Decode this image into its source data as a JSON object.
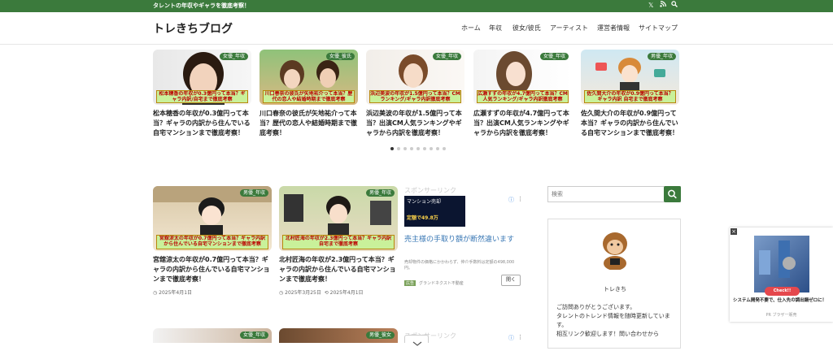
{
  "topbar": {
    "tagline": "タレントの年収やギャラを徹底考察！",
    "icons": [
      "x-icon",
      "rss-icon",
      "search-icon"
    ]
  },
  "header": {
    "logo": "トレきちブログ",
    "nav": [
      "ホーム",
      "年収",
      "彼女/彼氏",
      "アーティスト",
      "運営者情報",
      "サイトマップ"
    ]
  },
  "slider": {
    "cards": [
      {
        "category": "女優_年収",
        "caption": "松本穂香の年収が0.3億円って本当？ギャラ内訳/自宅まで徹底考察",
        "title": "松本穂香の年収が0.3億円って本当？ギャラの内訳から住んでいる自宅マンションまで徹底考察！"
      },
      {
        "category": "女優_彼氏",
        "caption": "川口春奈の彼氏が矢地祐介って本当？歴代の恋人や結婚時期まで徹底考察",
        "title": "川口春奈の彼氏が矢地祐介って本当？歴代の恋人や結婚時期まで徹底考察！"
      },
      {
        "category": "女優_年収",
        "caption": "浜辺美波の年収が1.5億円って本当？CMランキング/ギャラ内訳徹底考察",
        "title": "浜辺美波の年収が1.5億円って本当？出演CM人気ランキングやギャラから内訳を徹底考察！"
      },
      {
        "category": "女優_年収",
        "caption": "広瀬すずの年収が4.7億円って本当？CM人気ランキング/ギャラ内訳徹底考察",
        "title": "広瀬すずの年収が4.7億円って本当？出演CM人気ランキングやギャラから内訳を徹底考察！"
      },
      {
        "category": "男優_年収",
        "caption": "佐久間大介の年収が0.9億円って本当？ギャラ内訳 自宅まで徹底考察",
        "title": "佐久間大介の年収が0.9億円って本当？ギャラの内訳から住んでいる自宅マンションまで徹底考察！"
      }
    ],
    "dots": 9
  },
  "main": {
    "cards": [
      {
        "category": "男優_年収",
        "caption": "宮舘涼太の年収が0.7億円って本当？ギャラ内訳から住んでいる自宅マンションまで徹底考察",
        "title": "宮舘涼太の年収が0.7億円って本当？ギャラの内訳から住んでいる自宅マンションまで徹底考察！",
        "date": "2025年4月1日",
        "updated": ""
      },
      {
        "category": "男優_年収",
        "caption": "北村匠海の年収が2.3億円って本当？ギャラ内訳 自宅まで徹底考察",
        "title": "北村匠海の年収が2.3億円って本当？ギャラの内訳から住んでいる自宅マンションまで徹底考察！",
        "date": "2025年3月25日",
        "updated": "2025年4月1日"
      }
    ],
    "ad": {
      "label": "スポンサーリンク",
      "image_text": "マンション売却",
      "image_amount": "定額で49.8万",
      "headline": "売主様の手取り額が断然違います",
      "body": "売却物件の価格にかかわらず、仲介手数料は定額の498,000円。",
      "sponsor_badge": "広告",
      "sponsor": "グランドネクスト不動産",
      "button": "開く"
    },
    "lower_cards": [
      {
        "category": "女優_年収"
      },
      {
        "category": "男優_彼女"
      }
    ]
  },
  "sidebar": {
    "search_placeholder": "検索",
    "profile": {
      "name": "トレきち",
      "text1": "ご訪問ありがとうございます。",
      "text2": "タレントのトレンド情報を随時更新しています。",
      "text3": "相互リンク歓迎します！問い合わせから"
    }
  },
  "float_ad": {
    "button": "Check!!",
    "text": "システム開発不要で、仕入先の調出鍋ゼロに！",
    "pr": "PR ブラザー販売"
  },
  "colors": {
    "accent": "#3b7a3c",
    "caption_bg": "#c9f19a",
    "caption_text": "#bb0000"
  }
}
